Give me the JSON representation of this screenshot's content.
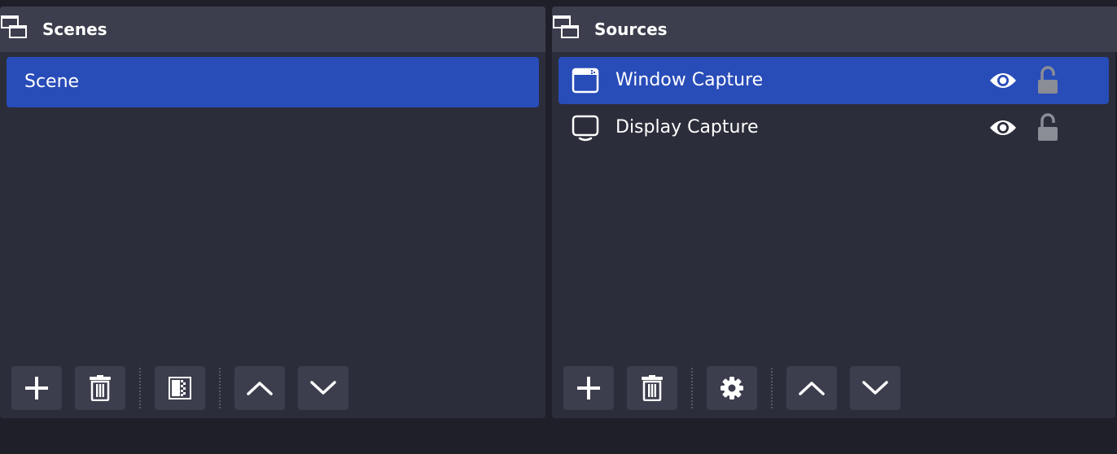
{
  "scenes": {
    "title": "Scenes",
    "items": [
      {
        "label": "Scene",
        "selected": true
      }
    ]
  },
  "sources": {
    "title": "Sources",
    "items": [
      {
        "label": "Window Capture",
        "icon": "window-capture-icon",
        "selected": true,
        "visible": true,
        "locked": false
      },
      {
        "label": "Display Capture",
        "icon": "display-capture-icon",
        "selected": false,
        "visible": true,
        "locked": false
      }
    ]
  },
  "icons": {
    "dock_header": "windows-stack-icon",
    "add": "plus-icon",
    "remove": "trash-icon",
    "filters": "filter-icon",
    "properties": "gear-icon",
    "move_up": "chevron-up-icon",
    "move_down": "chevron-down-icon",
    "visibility": "eye-icon",
    "lock": "unlocked-padlock-icon"
  },
  "colors": {
    "background": "#1e1f29",
    "panel": "#2b2d3a",
    "header": "#3c3e4e",
    "selection": "#284cb8",
    "button": "#3c3e4e",
    "text": "#ffffff",
    "lock_icon": "#8a8c96"
  }
}
